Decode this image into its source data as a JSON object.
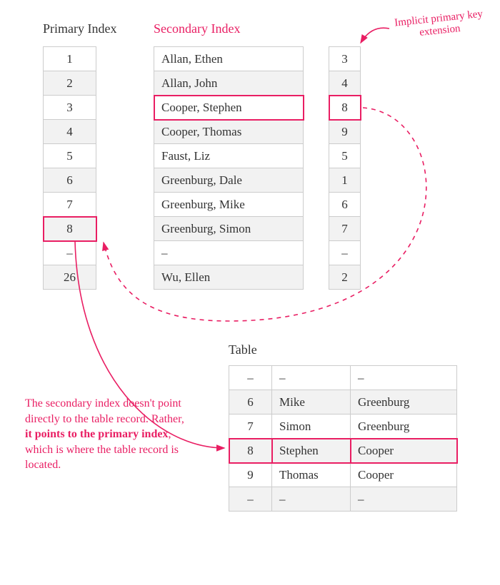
{
  "headings": {
    "primary": "Primary Index",
    "secondary": "Secondary Index",
    "table": "Table"
  },
  "primary": [
    "1",
    "2",
    "3",
    "4",
    "5",
    "6",
    "7",
    "8",
    "–",
    "26"
  ],
  "secondary_names": [
    "Allan, Ethen",
    "Allan, John",
    "Cooper, Stephen",
    "Cooper, Thomas",
    "Faust, Liz",
    "Greenburg, Dale",
    "Greenburg, Mike",
    "Greenburg, Simon",
    "–",
    "Wu, Ellen"
  ],
  "secondary_keys": [
    "3",
    "4",
    "8",
    "9",
    "5",
    "1",
    "6",
    "7",
    "–",
    "2"
  ],
  "table_rows": [
    [
      "–",
      "–",
      "–"
    ],
    [
      "6",
      "Mike",
      "Greenburg"
    ],
    [
      "7",
      "Simon",
      "Greenburg"
    ],
    [
      "8",
      "Stephen",
      "Cooper"
    ],
    [
      "9",
      "Thomas",
      "Cooper"
    ],
    [
      "–",
      "–",
      "–"
    ]
  ],
  "annotations": {
    "implicit": "Implicit primary key extension",
    "explain_part1": "The secondary index doesn't point directly to the table record. Rather, ",
    "explain_bold": "it points to the primary index",
    "explain_part2": ", which is where the table record is located."
  },
  "highlights": {
    "primary_row": 7,
    "secondary_row": 2,
    "table_row": 3
  }
}
